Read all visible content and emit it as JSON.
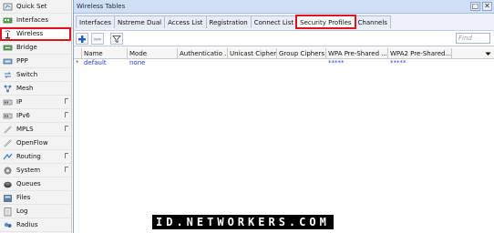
{
  "sidebar": {
    "items": [
      {
        "label": "Quick Set",
        "icon": "quick-set-icon",
        "submenu": false
      },
      {
        "label": "Interfaces",
        "icon": "interfaces-icon",
        "submenu": false
      },
      {
        "label": "Wireless",
        "icon": "wireless-icon",
        "submenu": false,
        "highlighted": true
      },
      {
        "label": "Bridge",
        "icon": "bridge-icon",
        "submenu": false
      },
      {
        "label": "PPP",
        "icon": "ppp-icon",
        "submenu": false
      },
      {
        "label": "Switch",
        "icon": "switch-icon",
        "submenu": false
      },
      {
        "label": "Mesh",
        "icon": "mesh-icon",
        "submenu": false
      },
      {
        "label": "IP",
        "icon": "ip-icon",
        "submenu": true
      },
      {
        "label": "IPv6",
        "icon": "ipv6-icon",
        "submenu": true
      },
      {
        "label": "MPLS",
        "icon": "mpls-icon",
        "submenu": true
      },
      {
        "label": "OpenFlow",
        "icon": "openflow-icon",
        "submenu": false
      },
      {
        "label": "Routing",
        "icon": "routing-icon",
        "submenu": true
      },
      {
        "label": "System",
        "icon": "system-icon",
        "submenu": true
      },
      {
        "label": "Queues",
        "icon": "queues-icon",
        "submenu": false
      },
      {
        "label": "Files",
        "icon": "files-icon",
        "submenu": false
      },
      {
        "label": "Log",
        "icon": "log-icon",
        "submenu": false
      },
      {
        "label": "Radius",
        "icon": "radius-icon",
        "submenu": false
      }
    ]
  },
  "window": {
    "title": "Wireless Tables",
    "maximize_glyph": "□",
    "close_glyph": "✕"
  },
  "tabs": [
    {
      "label": "Interfaces",
      "active": false
    },
    {
      "label": "Nstreme Dual",
      "active": false
    },
    {
      "label": "Access List",
      "active": false
    },
    {
      "label": "Registration",
      "active": false
    },
    {
      "label": "Connect List",
      "active": false
    },
    {
      "label": "Security Profiles",
      "active": true
    },
    {
      "label": "Channels",
      "active": false
    }
  ],
  "toolbar": {
    "add_icon": "plus-icon",
    "remove_icon": "minus-icon",
    "filter_icon": "filter-icon",
    "find_placeholder": "Find"
  },
  "table": {
    "columns": [
      "Name",
      "Mode",
      "Authenticatio ...",
      "Unicast Ciphers",
      "Group Ciphers",
      "WPA Pre-Shared ...",
      "WPA2 Pre-Shared..."
    ],
    "rows": [
      {
        "marker": "*",
        "name": "default",
        "mode": "none",
        "auth": "",
        "unicast": "",
        "group": "",
        "wpa_psk": "*****",
        "wpa2_psk": "*****"
      }
    ]
  },
  "watermark": {
    "text": "ID.NETWORKERS.COM"
  },
  "colors": {
    "highlight_border": "#e0141e",
    "titlebar": "#d0dff3",
    "value_text": "#2b3bd6"
  }
}
